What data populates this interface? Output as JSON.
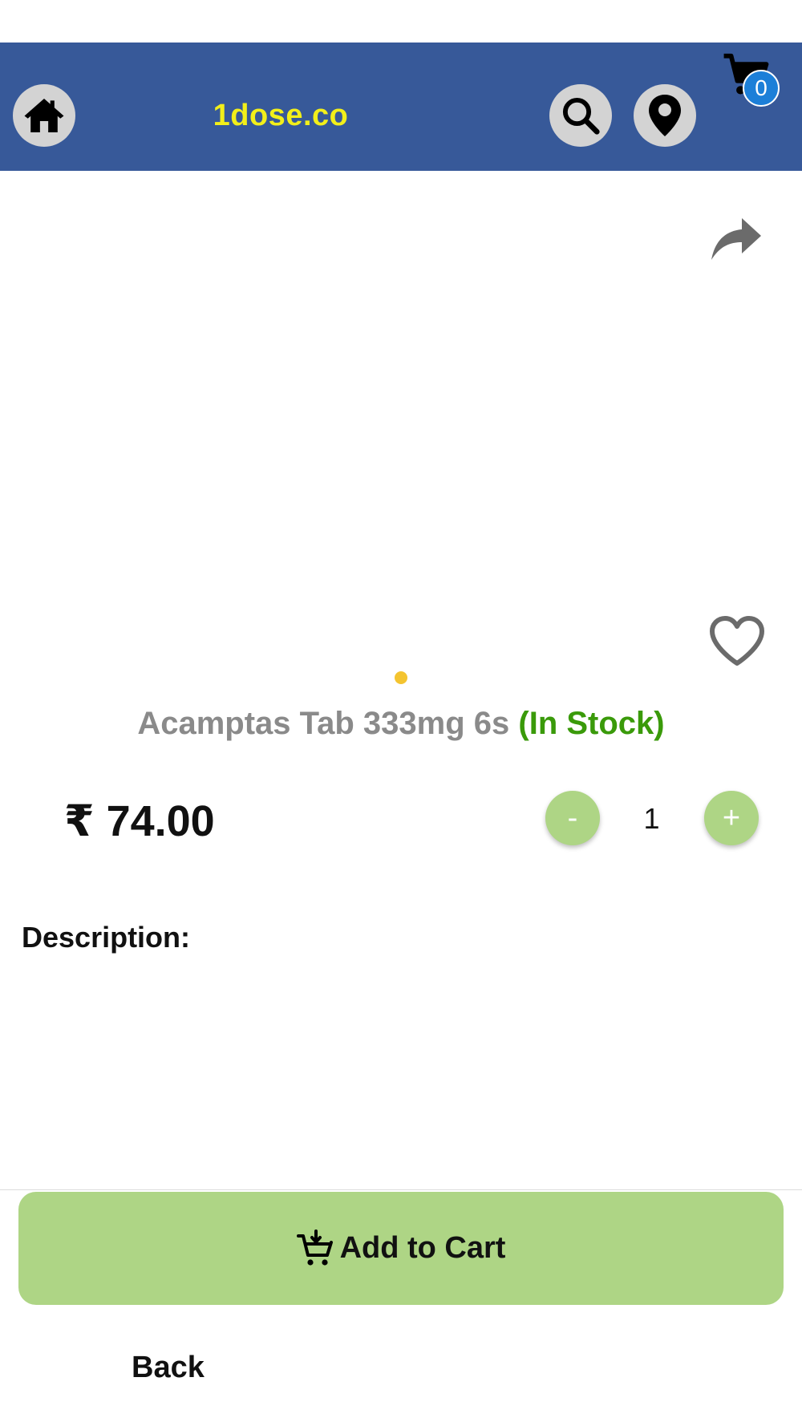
{
  "header": {
    "brand": "1dose.co",
    "cart_count": "0",
    "icons": [
      "home-icon",
      "search-icon",
      "location-pin-icon",
      "cart-icon"
    ],
    "background_color": "#375999",
    "brand_color": "#f2ef1a"
  },
  "product": {
    "share_icon": "share-icon",
    "favorite_icon": "heart-outline-icon",
    "image_pages": 1,
    "name": "Acamptas Tab 333mg 6s",
    "stock_status": "(In Stock)",
    "price": "₹ 74.00",
    "quantity": {
      "minus_label": "-",
      "value": "1",
      "plus_label": "+"
    },
    "description_label": "Description:"
  },
  "actions": {
    "add_to_cart_label": "Add to Cart",
    "add_to_cart_icon": "cart-download-icon",
    "back_label": "Back",
    "accent_color": "#aed585"
  }
}
